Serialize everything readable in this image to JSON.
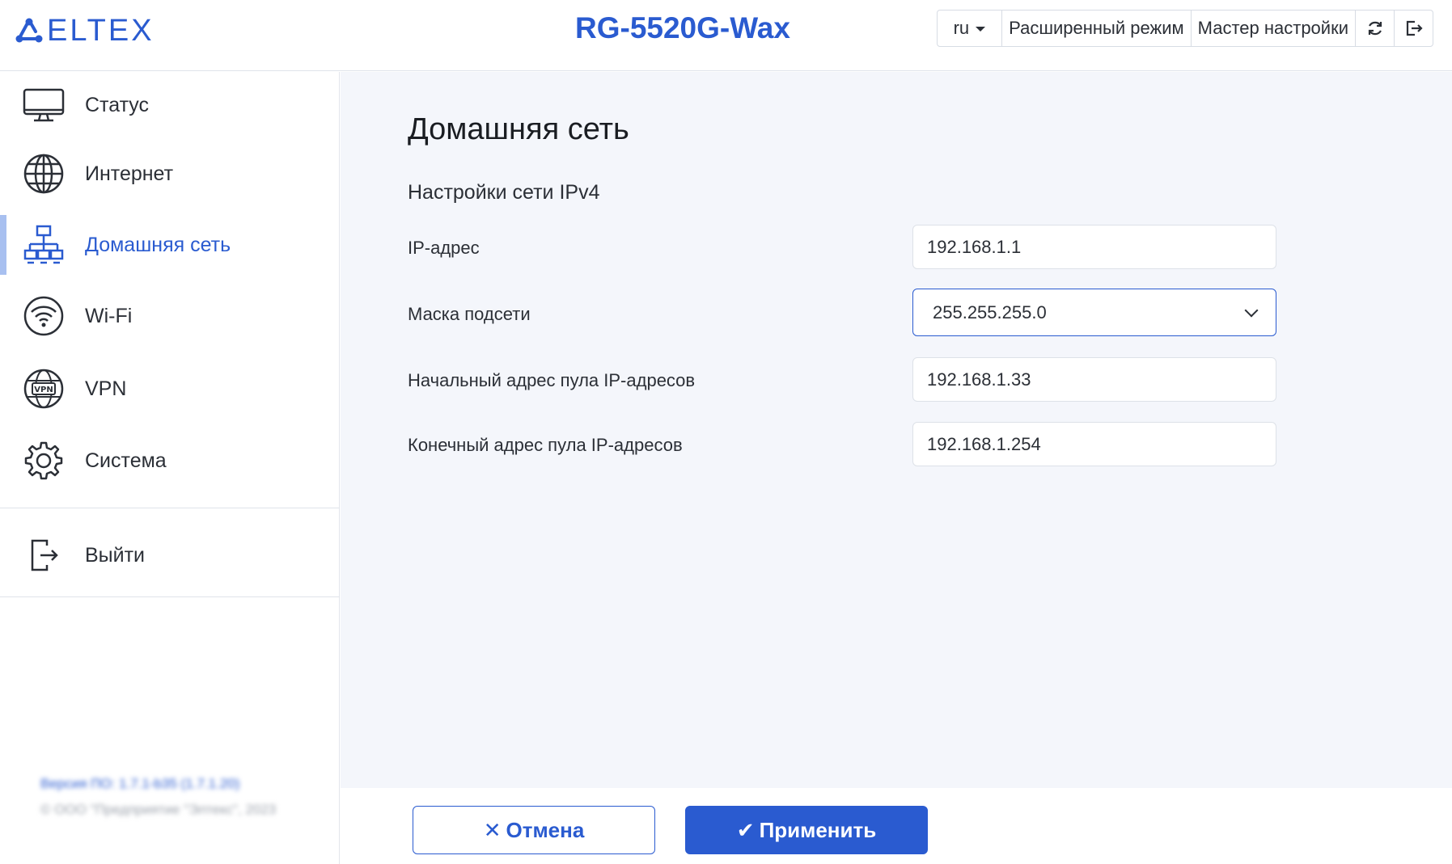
{
  "header": {
    "logo_text": "ELTEX",
    "device_title": "RG-5520G-Wax",
    "lang_label": "ru",
    "advanced_mode_label": "Расширенный режим",
    "wizard_label": "Мастер настройки",
    "refresh_icon": "refresh-icon",
    "logout_icon": "logout-icon"
  },
  "sidebar": {
    "items": [
      {
        "label": "Статус",
        "icon": "monitor-icon"
      },
      {
        "label": "Интернет",
        "icon": "globe-icon"
      },
      {
        "label": "Домашняя сеть",
        "icon": "network-icon",
        "active": true
      },
      {
        "label": "Wi-Fi",
        "icon": "wifi-icon"
      },
      {
        "label": "VPN",
        "icon": "vpn-globe-icon"
      },
      {
        "label": "Система",
        "icon": "gear-icon"
      }
    ],
    "logout_label": "Выйти",
    "footer_version": "Версия ПО: 1.7.1-b35 (1.7.1.20)",
    "footer_copyright": "© ООО \"Предприятие \"Элтекс\", 2023"
  },
  "main": {
    "page_title": "Домашняя сеть",
    "section_title": "Настройки сети IPv4",
    "fields": [
      {
        "label": "IP-адрес",
        "value": "192.168.1.1"
      },
      {
        "label": "Маска подсети",
        "value": "255.255.255.0"
      },
      {
        "label": "Начальный адрес пула IP-адресов",
        "value": "192.168.1.33"
      },
      {
        "label": "Конечный адрес пула IP-адресов",
        "value": "192.168.1.254"
      }
    ]
  },
  "actions": {
    "cancel_label": "Отмена",
    "apply_label": "Применить"
  },
  "colors": {
    "accent": "#2a5bd0",
    "content_bg": "#f4f6fb",
    "active_bar": "#a8c0f0"
  }
}
